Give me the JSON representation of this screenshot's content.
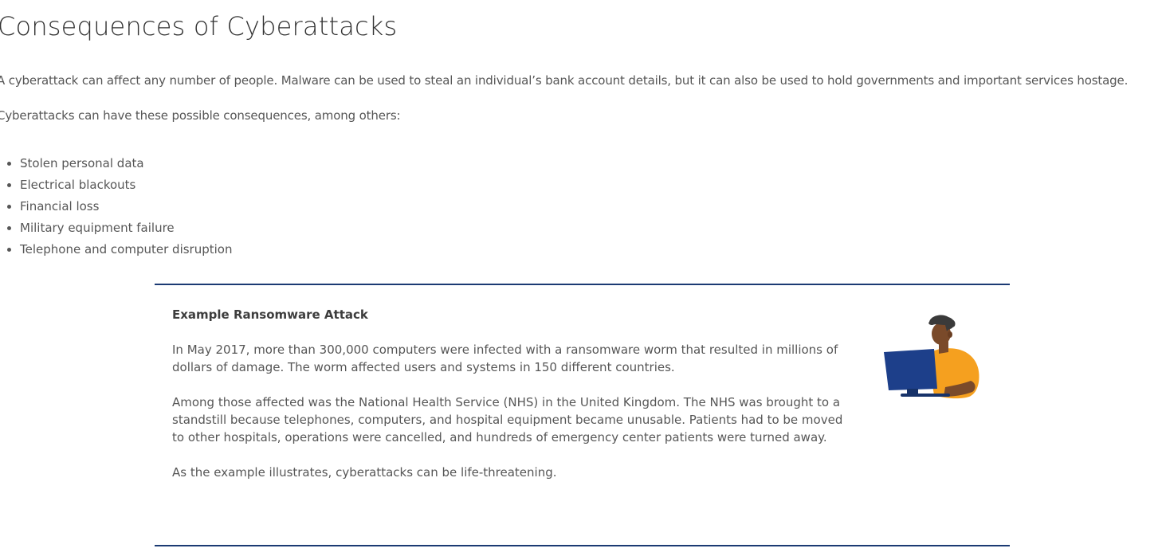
{
  "page": {
    "title": "Consequences of Cyberattacks",
    "intro": "A cyberattack can affect any number of people. Malware can be used to steal an individual’s bank account details, but it can also be used to hold governments and important services hostage.",
    "lead": "Cyberattacks can have these possible consequences, among others:",
    "consequences": [
      "Stolen personal data",
      "Electrical blackouts",
      "Financial loss",
      "Military equipment failure",
      "Telephone and computer disruption"
    ]
  },
  "example": {
    "heading": "Example Ransomware Attack",
    "paragraphs": [
      "In May 2017, more than 300,000 computers were infected with a ransomware worm that resulted in millions of dollars of damage. The worm affected users and systems in 150 different countries.",
      "Among those affected was the National Health Service (NHS) in the United Kingdom. The NHS was brought to a standstill because telephones, computers, and hospital equipment became unusable. Patients had to be moved to other hospitals, operations were cancelled, and hundreds of emergency center patients were turned away.",
      "As the example illustrates, cyberattacks can be life-threatening."
    ],
    "illustration_icon": "person-at-computer-icon",
    "colors": {
      "rule": "#1b3a73",
      "monitor": "#1d3f8a",
      "shirt": "#f5a01f",
      "skin": "#7a4a2a",
      "hair": "#3a3a3a"
    }
  }
}
